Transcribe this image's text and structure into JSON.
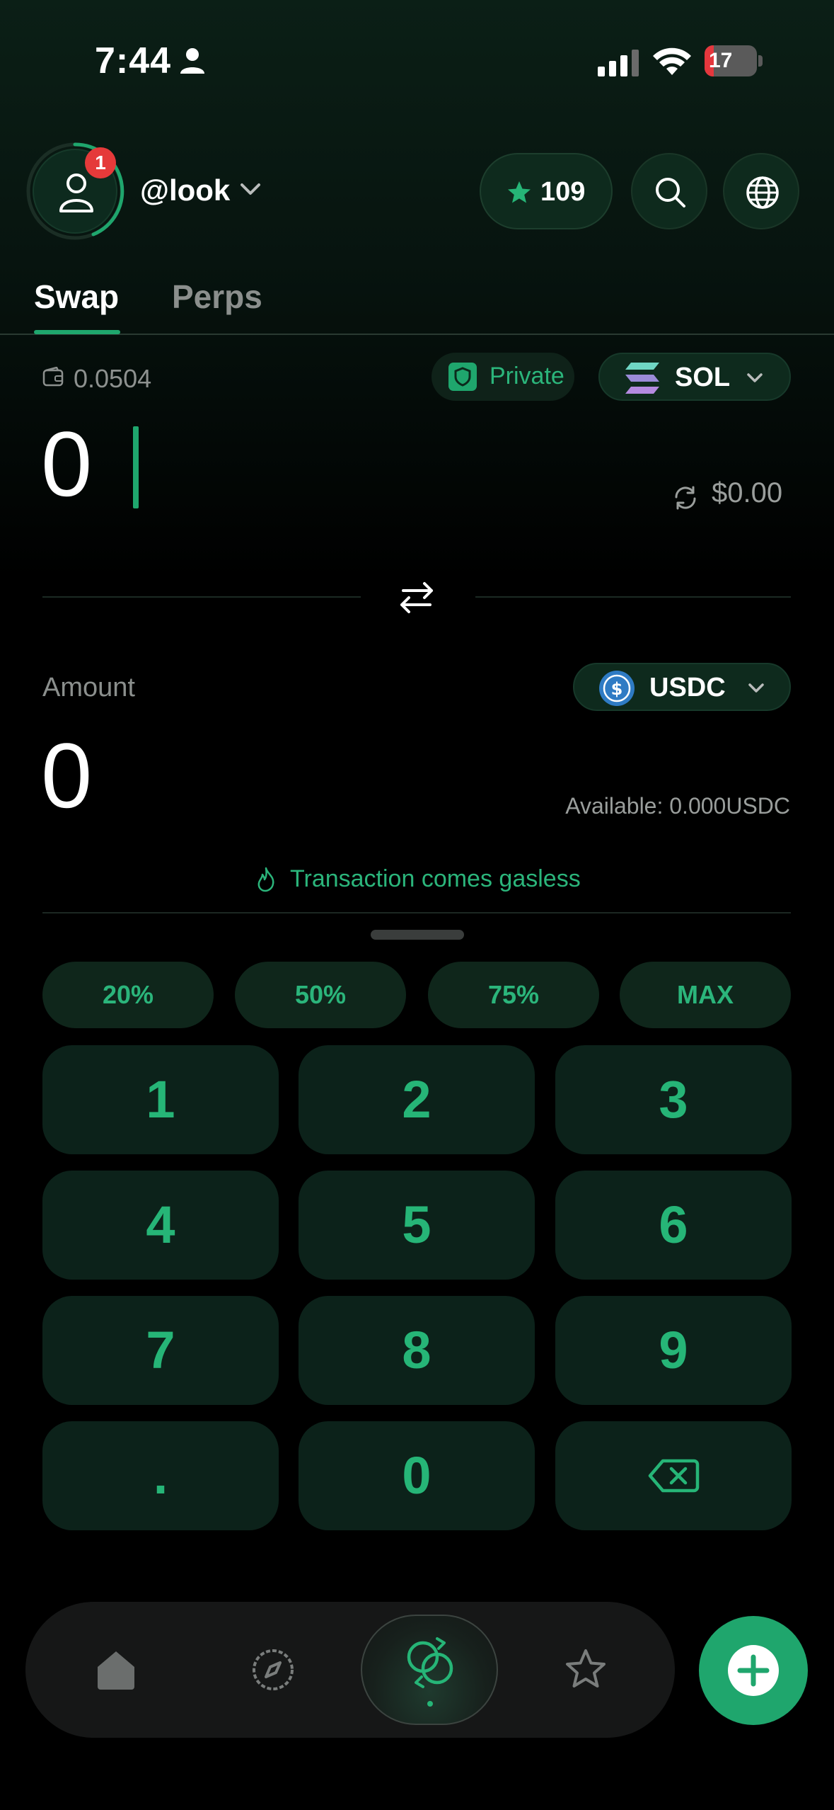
{
  "status_bar": {
    "time": "7:44",
    "battery": "17"
  },
  "header": {
    "username": "@look",
    "notification_count": "1",
    "stars": "109"
  },
  "tabs": [
    {
      "label": "Swap",
      "active": true
    },
    {
      "label": "Perps",
      "active": false
    }
  ],
  "from": {
    "wallet_balance": "0.0504",
    "private_label": "Private",
    "token": "SOL",
    "amount": "0",
    "usd_value": "$0.00"
  },
  "to": {
    "label": "Amount",
    "token": "USDC",
    "amount": "0",
    "available": "Available: 0.000USDC"
  },
  "gasless_note": "Transaction comes gasless",
  "percent_buttons": [
    "20%",
    "50%",
    "75%",
    "MAX"
  ],
  "keypad": [
    "1",
    "2",
    "3",
    "4",
    "5",
    "6",
    "7",
    "8",
    "9",
    ".",
    "0"
  ],
  "colors": {
    "accent": "#1fa66d",
    "accent_text": "#2bb57b",
    "badge": "#e53a3a"
  },
  "nav": {
    "items": [
      "home-icon",
      "compass-icon",
      "swap-icon",
      "star-icon"
    ],
    "active": "swap-icon",
    "fab": "plus-icon"
  }
}
